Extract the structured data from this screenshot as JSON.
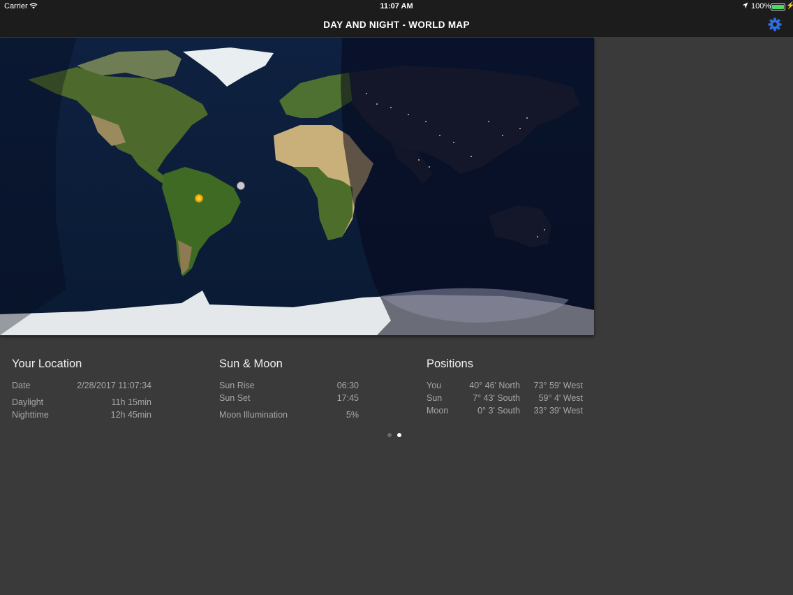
{
  "status_bar": {
    "carrier": "Carrier",
    "time": "11:07 AM",
    "battery_percent": "100%",
    "battery_level": 1.0,
    "icons": [
      "wifi-icon",
      "location-arrow-icon",
      "battery-icon",
      "charging-bolt-icon"
    ]
  },
  "nav": {
    "title": "DAY AND NIGHT - WORLD MAP",
    "settings_icon": "gear-icon",
    "accent_color": "#2f6fe0"
  },
  "map": {
    "description_icons": [
      "sun-marker-icon",
      "moon-marker-icon"
    ]
  },
  "your_location": {
    "title": "Your Location",
    "rows": [
      {
        "label": "Date",
        "value": "2/28/2017 11:07:34"
      },
      {
        "label": "Daylight",
        "value": "11h 15min"
      },
      {
        "label": "Nighttime",
        "value": "12h 45min"
      }
    ]
  },
  "sun_moon": {
    "title": "Sun & Moon",
    "rows": [
      {
        "label": "Sun Rise",
        "value": "06:30"
      },
      {
        "label": "Sun Set",
        "value": "17:45"
      },
      {
        "label": "Moon Illumination",
        "value": "5%"
      }
    ]
  },
  "positions": {
    "title": "Positions",
    "rows": [
      {
        "label": "You",
        "lat": "40° 46' North",
        "lon": "73° 59' West"
      },
      {
        "label": "Sun",
        "lat": "7° 43' South",
        "lon": "59° 4' West"
      },
      {
        "label": "Moon",
        "lat": "0° 3' South",
        "lon": "33° 39' West"
      }
    ]
  },
  "page_indicator": {
    "pages": 2,
    "current": 2
  }
}
